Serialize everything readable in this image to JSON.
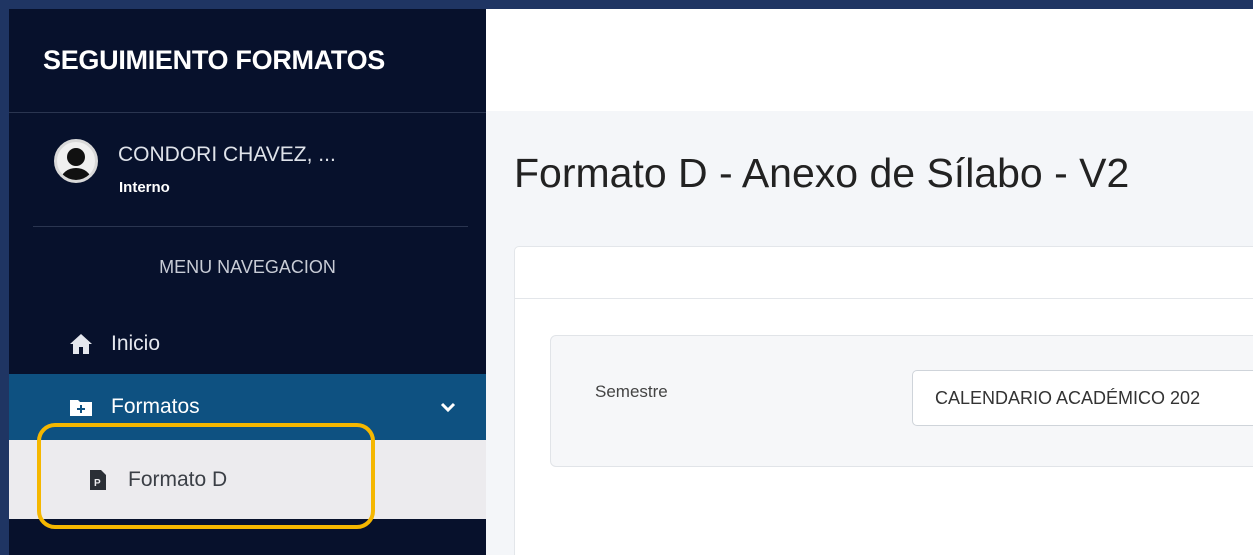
{
  "sidebar": {
    "brand": "SEGUIMIENTO FORMATOS",
    "user": {
      "name": "CONDORI CHAVEZ, ...",
      "role": "Interno"
    },
    "menu_header": "MENU NAVEGACION",
    "items": [
      {
        "label": "Inicio",
        "icon": "home-icon"
      },
      {
        "label": "Formatos",
        "icon": "folder-plus-icon",
        "active": true,
        "expanded": true
      },
      {
        "label": "Formato D",
        "icon": "file-pdf-icon",
        "sub": true
      }
    ]
  },
  "main": {
    "title": "Formato D - Anexo de Sílabo - V2",
    "filter": {
      "label": "Semestre",
      "selected": "CALENDARIO ACADÉMICO 202"
    }
  },
  "colors": {
    "background": "#1f3563",
    "sidebar": "#07112c",
    "active_item": "#0e5181",
    "highlight": "#f5b700"
  }
}
